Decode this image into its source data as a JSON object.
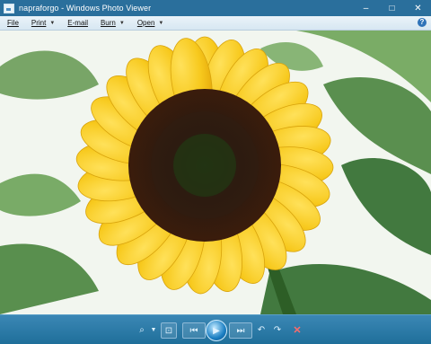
{
  "window": {
    "title": "napraforgo - Windows Photo Viewer"
  },
  "menu": {
    "file": "File",
    "print": "Print",
    "email": "E-mail",
    "burn": "Burn",
    "open": "Open"
  },
  "toolbar": {
    "icons": [
      "zoom-icon",
      "actual-size-icon",
      "previous-icon",
      "slideshow-icon",
      "next-icon",
      "rotate-left-icon",
      "rotate-right-icon",
      "delete-icon"
    ]
  },
  "colors": {
    "titlebar": "#2a6f9c",
    "toolbar": "#1f6f9a"
  }
}
